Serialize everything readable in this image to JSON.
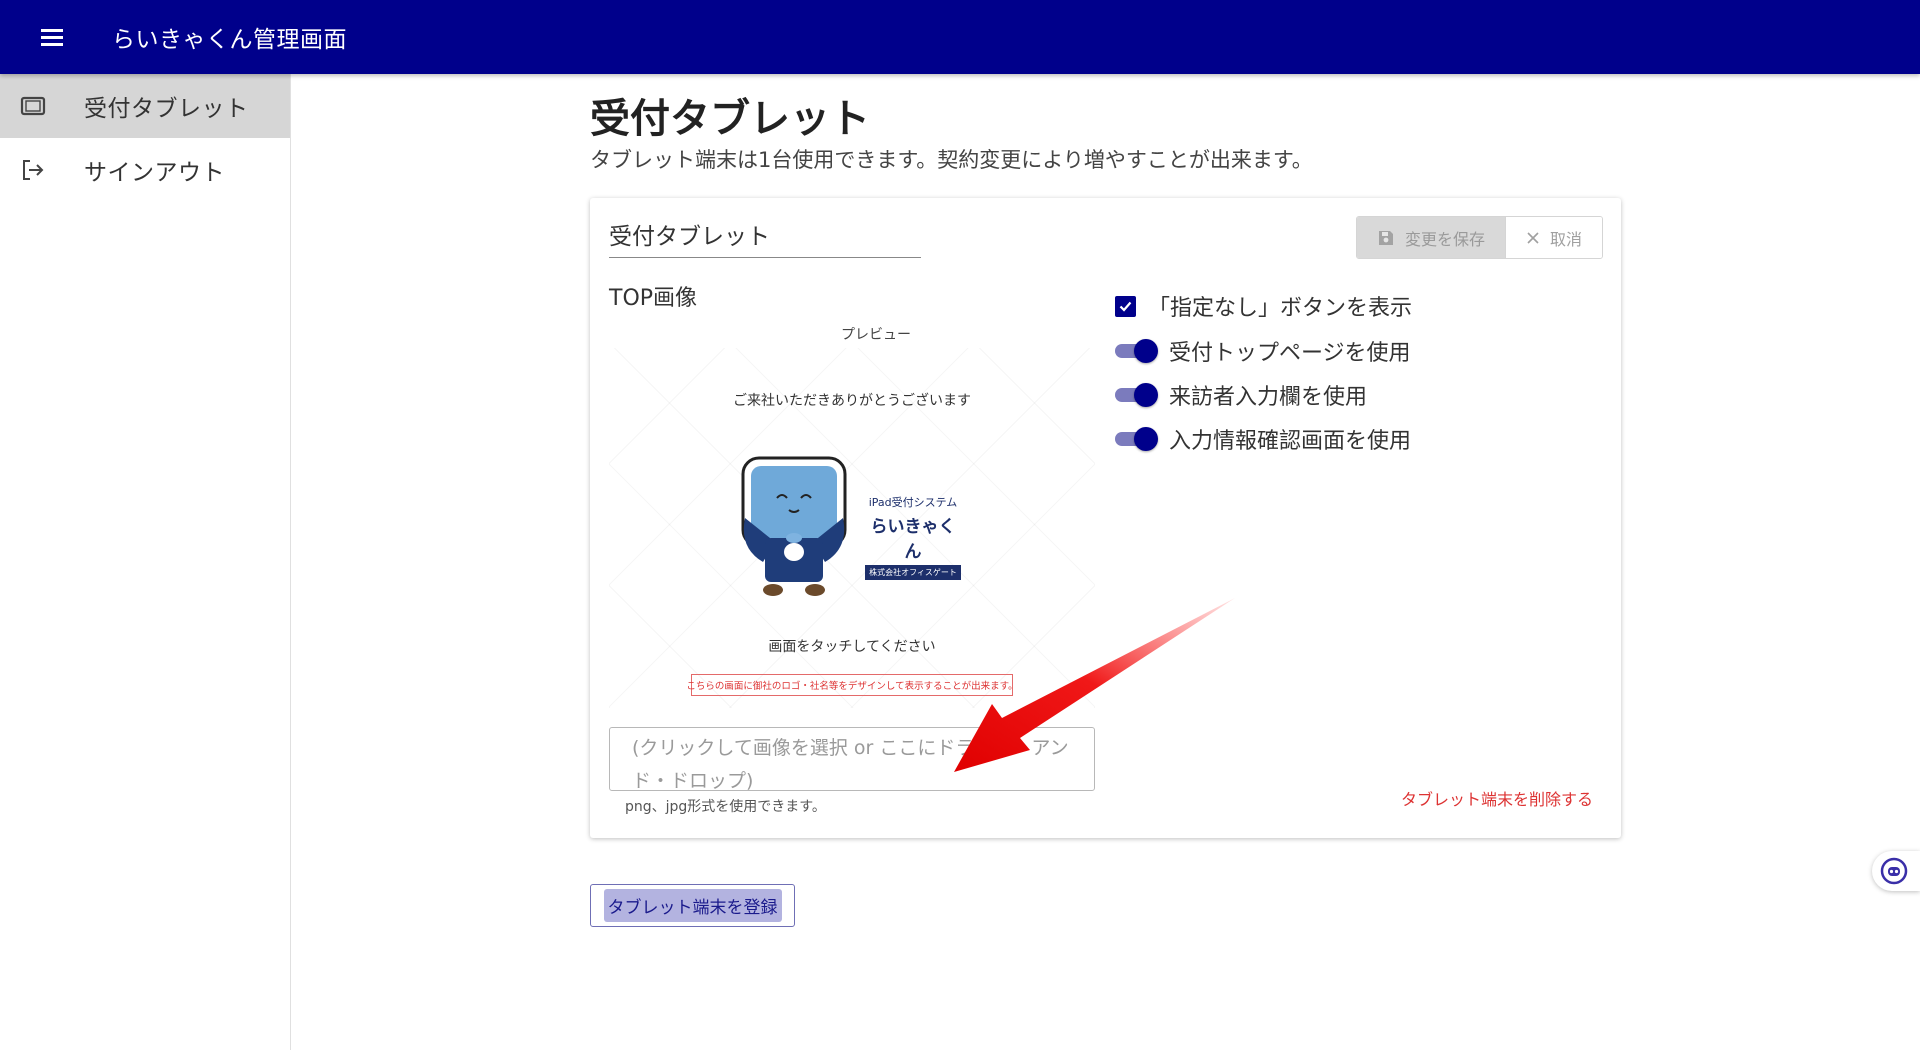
{
  "header": {
    "title": "らいきゃくん管理画面",
    "menu_icon": "hamburger-menu-icon",
    "background": "#00008b"
  },
  "sidebar": {
    "items": [
      {
        "label": "受付タブレット",
        "icon": "tablet-icon",
        "active": true
      },
      {
        "label": "サインアウト",
        "icon": "sign-out-icon",
        "active": false
      }
    ]
  },
  "main": {
    "title": "受付タブレット",
    "description": "タブレット端末は1台使用できます。契約変更により増やすことが出来ます。",
    "card": {
      "name_value": "受付タブレット",
      "save_label": "変更を保存",
      "cancel_label": "取消",
      "top_image_label": "TOP画像",
      "preview_label": "プレビュー",
      "preview": {
        "welcome": "ご来社いただきありがとうございます",
        "logo_line1": "iPad受付システム",
        "logo_line2": "らいきゃくん",
        "logo_line3": "株式会社オフィスゲート",
        "touch": "画面をタッチしてください",
        "notice": "こちらの画面に御社のロゴ・社名等をデザインして表示することが出来ます。"
      },
      "dropzone_text": "(クリックして画像を選択 or ここにドラッグ・アンド・ドロップ)",
      "format_hint": "png、jpg形式を使用できます。",
      "options": {
        "show_none_button": {
          "label": "「指定なし」ボタンを表示",
          "checked": true
        },
        "use_top_page": {
          "label": "受付トップページを使用",
          "on": true
        },
        "use_visitor_input": {
          "label": "来訪者入力欄を使用",
          "on": true
        },
        "use_confirm_screen": {
          "label": "入力情報確認画面を使用",
          "on": true
        }
      },
      "delete_link": "タブレット端末を削除する"
    },
    "register_button": "タブレット端末を登録"
  },
  "colors": {
    "primary": "#00008b",
    "toggle_track": "#7b7bbd",
    "danger": "#dd3333",
    "active_sidebar": "#d6d6d6"
  }
}
